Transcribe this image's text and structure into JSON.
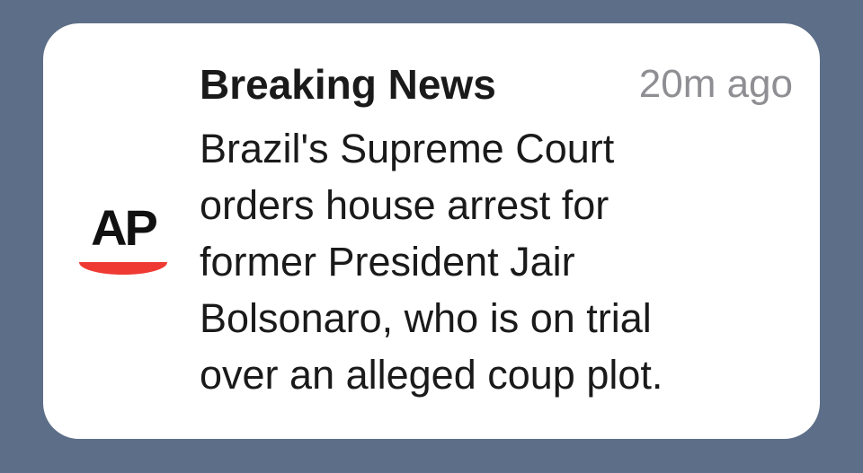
{
  "notification": {
    "app": "AP",
    "title": "Breaking News",
    "time": "20m ago",
    "body_lines": [
      "Brazil's Supreme Court",
      "orders house arrest for",
      "former President Jair",
      "Bolsonaro, who is on trial",
      "over an alleged coup plot."
    ],
    "icon": "ap-logo-icon"
  },
  "colors": {
    "background": "#5d6e88",
    "card": "#ffffff",
    "logo_accent": "#ef3a33",
    "secondary_text": "#8e8e93"
  }
}
